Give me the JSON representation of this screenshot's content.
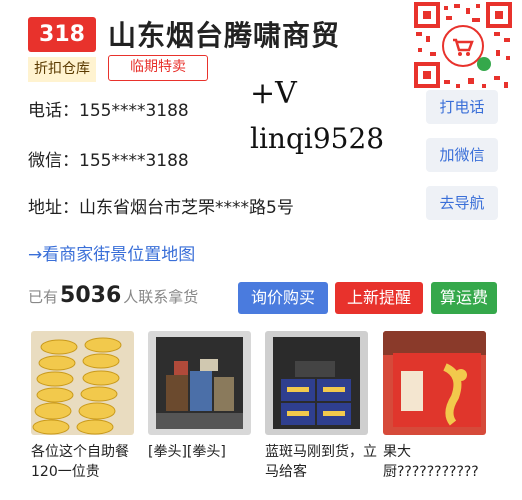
{
  "header": {
    "store_number": "318",
    "store_name": "山东烟台腾啸商贸",
    "tag_warehouse": "折扣仓库",
    "tag_clearance": "临期特卖"
  },
  "contact": {
    "phone": "电话：155****3188",
    "wechat": "微信：155****3188",
    "address": "地址：山东省烟台市芝罘****路5号"
  },
  "overlay": {
    "line1": "+V",
    "line2": "linqi9528"
  },
  "side_buttons": {
    "call": "打电话",
    "add_wechat": "加微信",
    "navigate": "去导航"
  },
  "map_link": "→看商家街景位置地图",
  "stats": {
    "prefix": "已有",
    "count": "5036",
    "suffix": "人联系拿货"
  },
  "actions": {
    "inquire": "询价购买",
    "new_arrival": "上新提醒",
    "freight": "算运费"
  },
  "products": [
    {
      "caption": "各位这个自助餐120一位贵"
    },
    {
      "caption": "[拳头][拳头]"
    },
    {
      "caption": "蓝斑马刚到货，立马给客"
    },
    {
      "caption": "果大厨???????????"
    }
  ],
  "colors": {
    "brand_red": "#e8322c",
    "link_blue": "#3a6fd8",
    "inquire_blue": "#4a7bde",
    "freight_green": "#35a84b"
  }
}
